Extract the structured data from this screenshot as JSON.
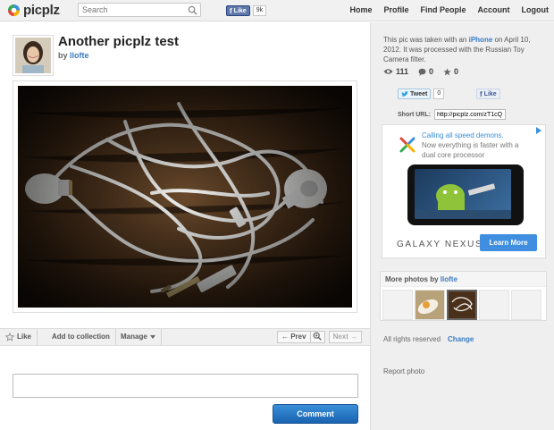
{
  "header": {
    "logo_text": "picplz",
    "search_placeholder": "Search",
    "fb_like": "Like",
    "fb_count": "9k",
    "nav": [
      "Home",
      "Profile",
      "Find People",
      "Account",
      "Logout"
    ]
  },
  "photo": {
    "title": "Another picplz test",
    "by_label": "by",
    "author": "llofte"
  },
  "toolbar": {
    "like": "Like",
    "add_to_collection": "Add to collection",
    "manage": "Manage",
    "prev": "← Prev",
    "next": "Next →"
  },
  "comment": {
    "button": "Comment"
  },
  "sidebar": {
    "info_pre": "This pic was taken with an ",
    "device": "iPhone",
    "info_post": " on April 10, 2012. It was processed with the Russian Toy Camera filter.",
    "views": "111",
    "comments": "0",
    "likes": "0",
    "tweet": "Tweet",
    "tweet_count": "0",
    "fb_like": "Like",
    "short_url_label": "Short URL:",
    "short_url": "http://picplz.com/zT1cQ",
    "more_photos_label": "More photos by ",
    "more_photos_user": "llofte",
    "rights_text": "All rights reserved",
    "rights_change": "Change",
    "report": "Report photo"
  },
  "ad": {
    "headline": "Calling all speed demons.",
    "line2": "Now everything is faster with a dual core processor",
    "brand": "GALAXY NEXUS",
    "cta": "Learn More"
  },
  "colors": {
    "link": "#3a7ac0",
    "button": "#1a63b0",
    "facebook": "#5f78ab"
  }
}
